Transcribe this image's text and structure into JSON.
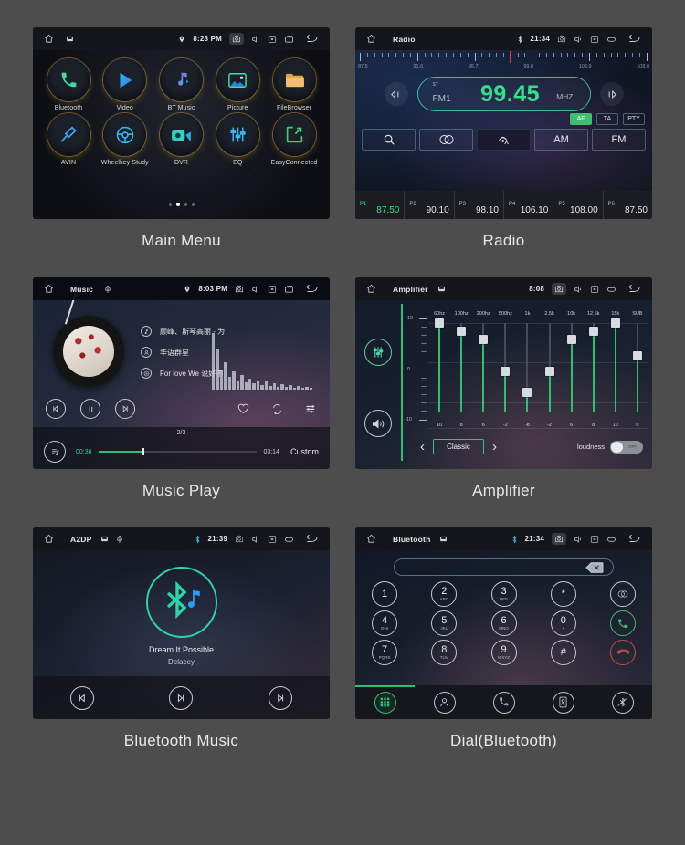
{
  "panels": [
    {
      "caption": "Main Menu",
      "status": {
        "title": "",
        "time": "8:28 PM",
        "icons": [
          "home-icon",
          "sd-card-icon",
          "location-pin-icon",
          "camera-icon",
          "volume-icon",
          "close-icon",
          "recent-apps-icon",
          "back-icon"
        ]
      },
      "apps_row1": [
        {
          "label": "Bluetooth",
          "icon": "phone-icon"
        },
        {
          "label": "Video",
          "icon": "play-icon"
        },
        {
          "label": "BT Music",
          "icon": "music-note-icon"
        },
        {
          "label": "Picture",
          "icon": "image-icon"
        },
        {
          "label": "FileBrowser",
          "icon": "folder-icon"
        }
      ],
      "apps_row2": [
        {
          "label": "AVIN",
          "icon": "aux-plug-icon"
        },
        {
          "label": "Wheelkey Study",
          "icon": "steering-wheel-icon"
        },
        {
          "label": "DVR",
          "icon": "video-camera-icon"
        },
        {
          "label": "EQ",
          "icon": "equalizer-icon"
        },
        {
          "label": "EasyConnected",
          "icon": "screen-mirror-icon"
        }
      ],
      "page_dots": 4,
      "page_active": 1
    },
    {
      "caption": "Radio",
      "status": {
        "title": "Radio",
        "time": "21:34"
      },
      "scale_labels": [
        "87.5",
        "91.6",
        "95.7",
        "99.8",
        "103.9",
        "108.0"
      ],
      "cursor_percent": 52,
      "stereo_label": "ST",
      "band_label": "FM1",
      "frequency": "99.45",
      "unit": "MHZ",
      "rds": [
        {
          "label": "AF",
          "active": true
        },
        {
          "label": "TA",
          "active": false
        },
        {
          "label": "PTY",
          "active": false
        }
      ],
      "buttons": [
        {
          "label": "",
          "icon": "search-icon",
          "dark": false
        },
        {
          "label": "",
          "icon": "stereo-icon",
          "dark": false
        },
        {
          "label": "",
          "icon": "signal-local-icon",
          "dark": true
        },
        {
          "label": "AM",
          "icon": "",
          "dark": false
        },
        {
          "label": "FM",
          "icon": "",
          "dark": false
        }
      ],
      "presets": [
        {
          "name": "P1",
          "freq": "87.50",
          "active": true
        },
        {
          "name": "P2",
          "freq": "90.10",
          "active": false
        },
        {
          "name": "P3",
          "freq": "98.10",
          "active": false
        },
        {
          "name": "P4",
          "freq": "106.10",
          "active": false
        },
        {
          "name": "P5",
          "freq": "108.00",
          "active": false
        },
        {
          "name": "P6",
          "freq": "87.50",
          "active": false
        }
      ]
    },
    {
      "caption": "Music Play",
      "status": {
        "title": "Music",
        "time": "8:03 PM"
      },
      "track_title": "顾峰、斯琴高丽 - 为",
      "artist": "华语群星",
      "album": "For love We 说好不",
      "page_indicator": "2/3",
      "elapsed": "00:36",
      "duration": "03:14",
      "progress_percent": 18,
      "custom_label": "Custom",
      "controls": [
        "previous-icon",
        "pause-icon",
        "next-icon",
        "favorite-icon",
        "repeat-icon",
        "playlist-eq-icon"
      ]
    },
    {
      "caption": "Amplifier",
      "status": {
        "title": "Amplifier",
        "time": "8:08"
      },
      "axis_top": "10",
      "axis_mid": "0",
      "axis_bottom": "-10",
      "bands": [
        {
          "freq": "60hz",
          "value": "10"
        },
        {
          "freq": "100hz",
          "value": "8"
        },
        {
          "freq": "200hz",
          "value": "6"
        },
        {
          "freq": "500hz",
          "value": "-2"
        },
        {
          "freq": "1k",
          "value": "-8"
        },
        {
          "freq": "2.5k",
          "value": "-2"
        },
        {
          "freq": "10k",
          "value": "6"
        },
        {
          "freq": "12.5k",
          "value": "8"
        },
        {
          "freq": "15k",
          "value": "10"
        },
        {
          "freq": "SUB",
          "value": "0"
        }
      ],
      "preset_name": "Classic",
      "loudness_label": "loudness",
      "loudness_state": "OFF"
    },
    {
      "caption": "Bluetooth Music",
      "status": {
        "title": "A2DP",
        "time": "21:39"
      },
      "track_title": "Dream It Possible",
      "artist": "Delacey",
      "controls": [
        "previous-icon",
        "play-pause-icon",
        "next-icon"
      ]
    },
    {
      "caption": "Dial(Bluetooth)",
      "status": {
        "title": "Bluetooth",
        "time": "21:34"
      },
      "input_value": "",
      "keys": [
        [
          {
            "n": "1",
            "s": ""
          },
          {
            "n": "2",
            "s": "ABC"
          },
          {
            "n": "3",
            "s": "DEF"
          },
          {
            "n": "*",
            "s": ""
          },
          {
            "n": "",
            "s": "",
            "icon": "hide-keypad-icon"
          }
        ],
        [
          {
            "n": "4",
            "s": "GHI"
          },
          {
            "n": "5",
            "s": "JKL"
          },
          {
            "n": "6",
            "s": "MNO"
          },
          {
            "n": "0",
            "s": "+"
          },
          {
            "n": "",
            "s": "",
            "icon": "call-icon",
            "style": "green"
          }
        ],
        [
          {
            "n": "7",
            "s": "PQRS"
          },
          {
            "n": "8",
            "s": "TUV"
          },
          {
            "n": "9",
            "s": "WXYZ"
          },
          {
            "n": "#",
            "s": ""
          },
          {
            "n": "",
            "s": "",
            "icon": "hangup-icon",
            "style": "red"
          }
        ]
      ],
      "tabs": [
        "keypad-icon",
        "contacts-icon",
        "call-log-icon",
        "sim-contacts-icon",
        "bluetooth-settings-icon"
      ],
      "active_tab": 0
    }
  ],
  "colors": {
    "page_bg": "#4d4d4d",
    "accent_green": "#2fbf72",
    "freq_green": "#35e08a",
    "cyan": "#2fd3a8",
    "caption": "#e8e8e8"
  }
}
